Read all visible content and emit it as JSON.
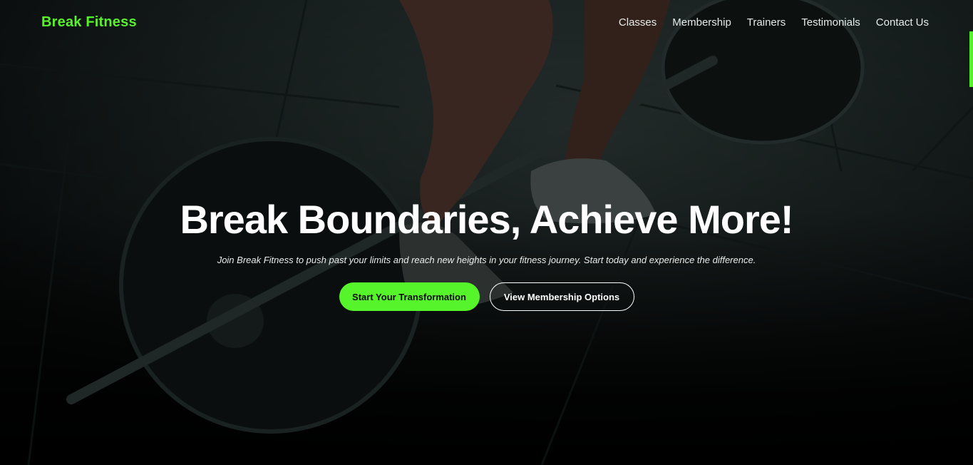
{
  "brand": {
    "name": "Break Fitness",
    "accent_color": "#56f42a"
  },
  "nav": {
    "items": [
      {
        "label": "Classes"
      },
      {
        "label": "Membership"
      },
      {
        "label": "Trainers"
      },
      {
        "label": "Testimonials"
      },
      {
        "label": "Contact Us"
      }
    ]
  },
  "hero": {
    "headline": "Break Boundaries, Achieve More!",
    "subtitle": "Join Break Fitness to push past your limits and reach new heights in your fitness journey. Start today and experience the difference.",
    "primary_cta": "Start Your Transformation",
    "secondary_cta": "View Membership Options",
    "background_image": "gym-deadlift-icon"
  }
}
